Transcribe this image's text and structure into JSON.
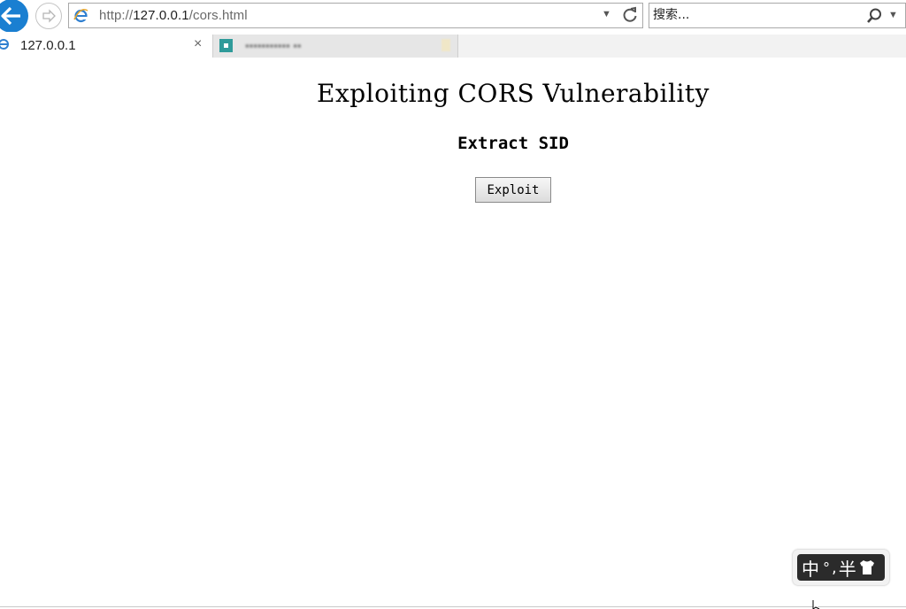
{
  "browser": {
    "address_url_prefix": "http://",
    "address_url_host": "127.0.0.1",
    "address_url_path": "/cors.html",
    "search_placeholder": "搜索...",
    "tabs": [
      {
        "label": "127.0.0.1",
        "close": "×"
      }
    ],
    "accent_color": "#1a7fd1"
  },
  "page": {
    "heading": "Exploiting CORS Vulnerability",
    "subheading": "Extract SID",
    "button_label": "Exploit"
  },
  "ime": {
    "mode": "中",
    "punct_dot": "°",
    "punct_comma": ",",
    "width_mode": "半"
  }
}
